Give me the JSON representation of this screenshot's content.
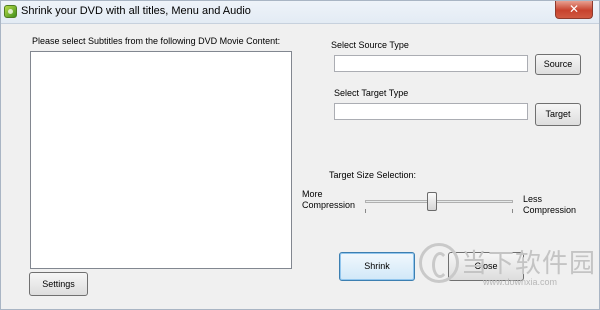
{
  "window": {
    "title": "Shrink your DVD with all titles, Menu and Audio",
    "close_glyph": "✕"
  },
  "subtitles": {
    "prompt": "Please select Subtitles from the following DVD Movie Content:",
    "items": []
  },
  "source": {
    "label": "Select Source Type",
    "value": "",
    "button": "Source"
  },
  "target": {
    "label": "Select Target Type",
    "value": "",
    "button": "Target"
  },
  "size_selection": {
    "label": "Target Size Selection:",
    "left_label_line1": "More",
    "left_label_line2": "Compression",
    "right_label_line1": "Less",
    "right_label_line2": "Compression",
    "slider_value_fraction": 0.45
  },
  "buttons": {
    "settings": "Settings",
    "shrink": "Shrink",
    "close": "Close"
  },
  "watermark": {
    "text_cn": "当下软件园",
    "url": "www.downxia.com"
  },
  "colors": {
    "window_bg": "#f0f0f0",
    "close_button": "#c7422d",
    "focus_border": "#3c7fb1"
  }
}
